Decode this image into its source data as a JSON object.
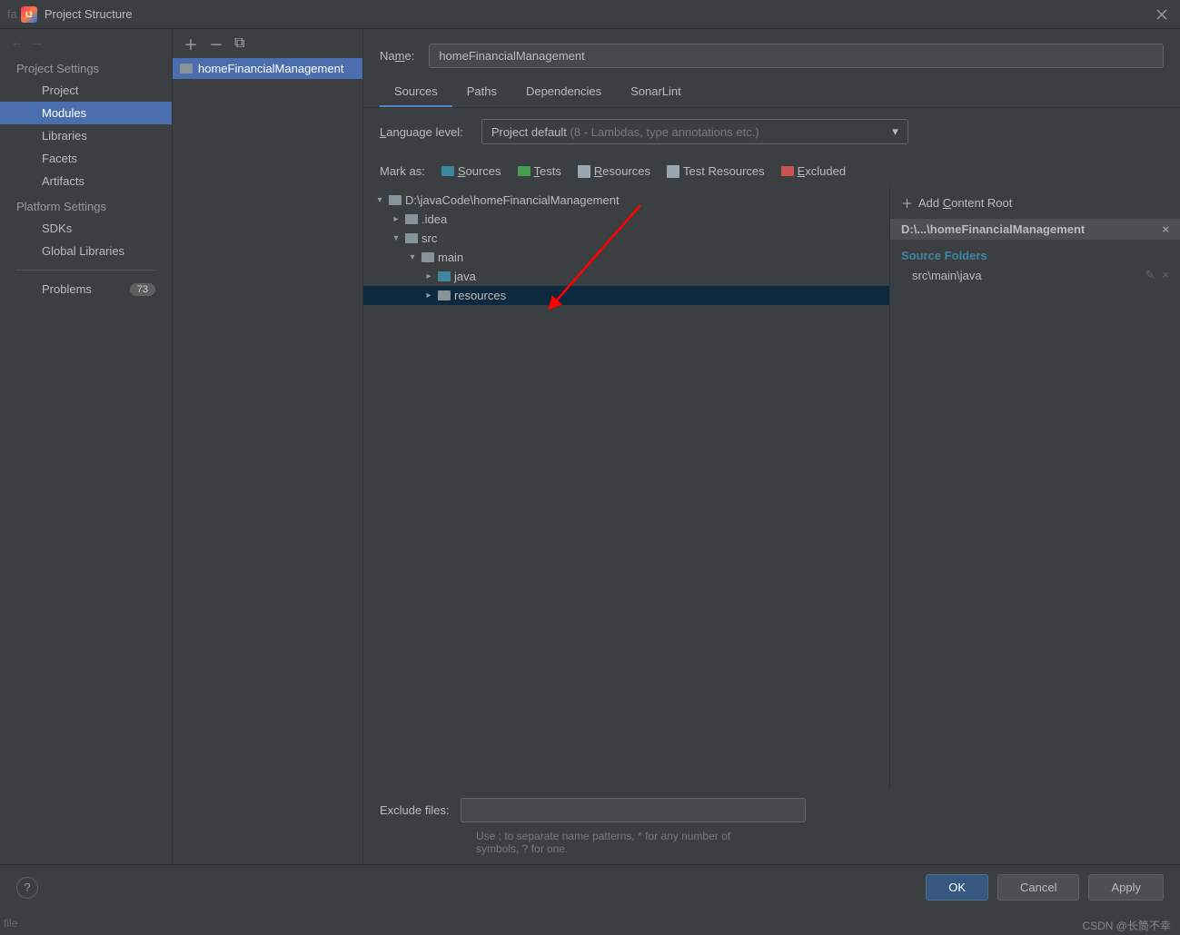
{
  "window": {
    "title": "Project Structure",
    "prefix": "fa"
  },
  "sidebar": {
    "sections": {
      "project_settings": "Project Settings",
      "platform_settings": "Platform Settings"
    },
    "items": {
      "project": "Project",
      "modules": "Modules",
      "libraries": "Libraries",
      "facets": "Facets",
      "artifacts": "Artifacts",
      "sdks": "SDKs",
      "global_libraries": "Global Libraries",
      "problems": "Problems"
    },
    "problems_count": "73"
  },
  "module_list": {
    "selected": "homeFinancialManagement"
  },
  "module_detail": {
    "name_label": "Name:",
    "name_value": "homeFinancialManagement",
    "tabs": {
      "sources": "Sources",
      "paths": "Paths",
      "dependencies": "Dependencies",
      "sonarlint": "SonarLint"
    },
    "language_level_label": "Language level:",
    "language_level_value": "Project default",
    "language_level_hint": "(8 - Lambdas, type annotations etc.)",
    "mark_as_label": "Mark as:",
    "mark_buttons": {
      "sources": "Sources",
      "tests": "Tests",
      "resources": "Resources",
      "test_resources": "Test Resources",
      "excluded": "Excluded"
    },
    "tree": {
      "root": "D:\\javaCode\\homeFinancialManagement",
      "idea": ".idea",
      "src": "src",
      "main": "main",
      "java": "java",
      "resources": "resources"
    },
    "right_panel": {
      "add_content_root": "Add Content Root",
      "content_root_path": "D:\\...\\homeFinancialManagement",
      "source_folders_label": "Source Folders",
      "source_folder_1": "src\\main\\java"
    },
    "exclude_files_label": "Exclude files:",
    "exclude_hint_1": "Use ; to separate name patterns, * for any number of",
    "exclude_hint_2": "symbols, ? for one."
  },
  "footer": {
    "ok": "OK",
    "cancel": "Cancel",
    "apply": "Apply"
  },
  "watermark": "CSDN @长筒不幸",
  "statusbar": "file"
}
